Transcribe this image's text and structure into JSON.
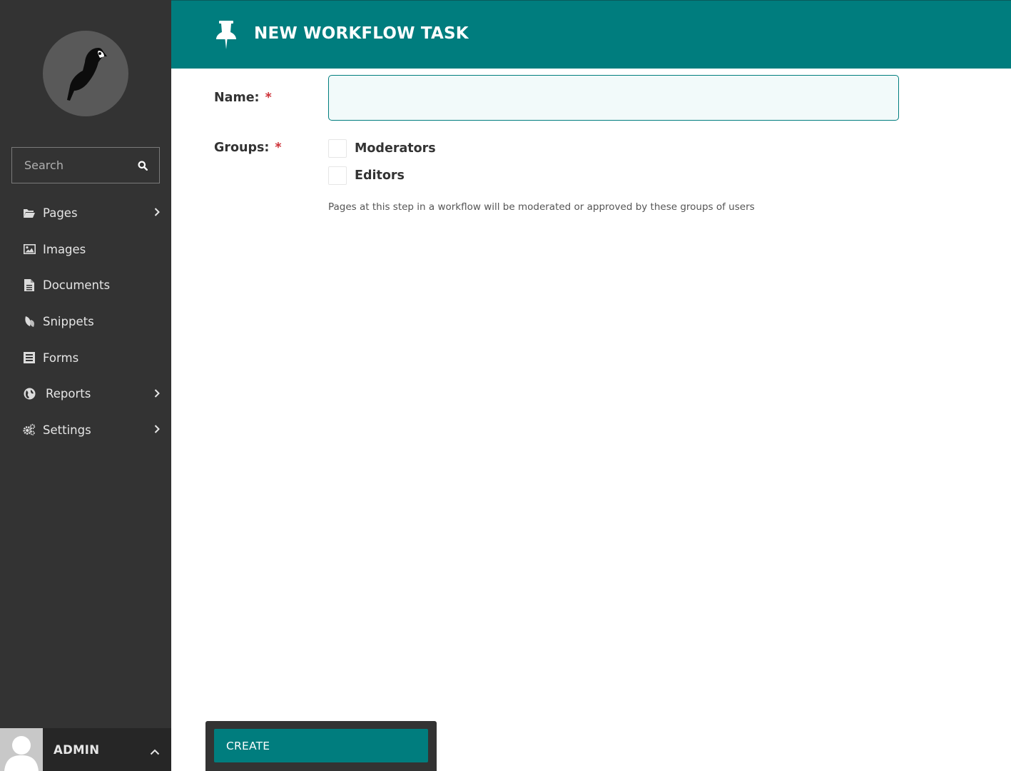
{
  "sidebar": {
    "search_placeholder": "Search",
    "menu": [
      {
        "label": "Pages",
        "icon": "folder-open-icon",
        "has_submenu": true
      },
      {
        "label": "Images",
        "icon": "image-icon",
        "has_submenu": false
      },
      {
        "label": "Documents",
        "icon": "document-icon",
        "has_submenu": false
      },
      {
        "label": "Snippets",
        "icon": "snippet-icon",
        "has_submenu": false
      },
      {
        "label": "Forms",
        "icon": "form-icon",
        "has_submenu": false
      },
      {
        "label": "Reports",
        "icon": "globe-icon",
        "has_submenu": true
      },
      {
        "label": "Settings",
        "icon": "cogs-icon",
        "has_submenu": true
      }
    ],
    "account": {
      "name": "ADMIN"
    }
  },
  "header": {
    "title": "NEW WORKFLOW TASK",
    "icon": "thumbtack-icon"
  },
  "form": {
    "name_label": "Name:",
    "name_value": "",
    "groups_label": "Groups:",
    "required_marker": "*",
    "groups": [
      {
        "label": "Moderators",
        "checked": false
      },
      {
        "label": "Editors",
        "checked": false
      }
    ],
    "groups_help": "Pages at this step in a workflow will be moderated or approved by these groups of users"
  },
  "footer": {
    "create_label": "CREATE"
  },
  "colors": {
    "teal": "#007d7e",
    "sidebar": "#333333",
    "required": "#cd3238"
  }
}
